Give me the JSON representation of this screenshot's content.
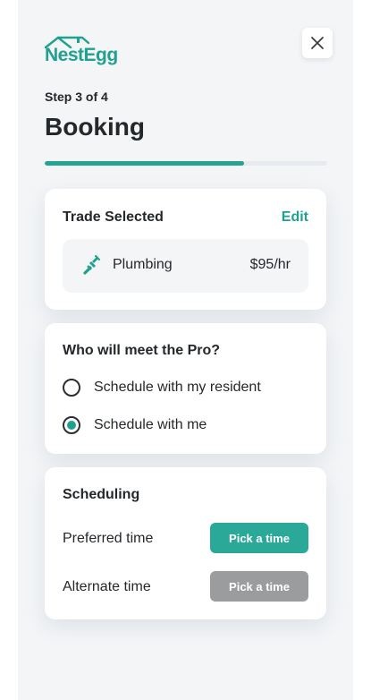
{
  "brand": {
    "name": "NestEgg",
    "color": "#20a190"
  },
  "header": {
    "step": "Step 3 of 4",
    "title": "Booking",
    "progress_fraction": 0.705
  },
  "trade_card": {
    "title": "Trade Selected",
    "edit_label": "Edit",
    "trade": {
      "icon": "plumbing-icon",
      "name": "Plumbing",
      "price": "$95/hr"
    }
  },
  "meet_card": {
    "title": "Who will meet the Pro?",
    "options": [
      {
        "label": "Schedule with my resident",
        "selected": false
      },
      {
        "label": "Schedule with me",
        "selected": true
      }
    ]
  },
  "scheduling_card": {
    "title": "Scheduling",
    "rows": [
      {
        "label": "Preferred time",
        "button": "Pick a time",
        "enabled": true
      },
      {
        "label": "Alternate time",
        "button": "Pick a time",
        "enabled": false
      }
    ]
  },
  "colors": {
    "accent": "#26a393",
    "disabled": "#9a9c9e",
    "background": "#f3f5f7"
  }
}
